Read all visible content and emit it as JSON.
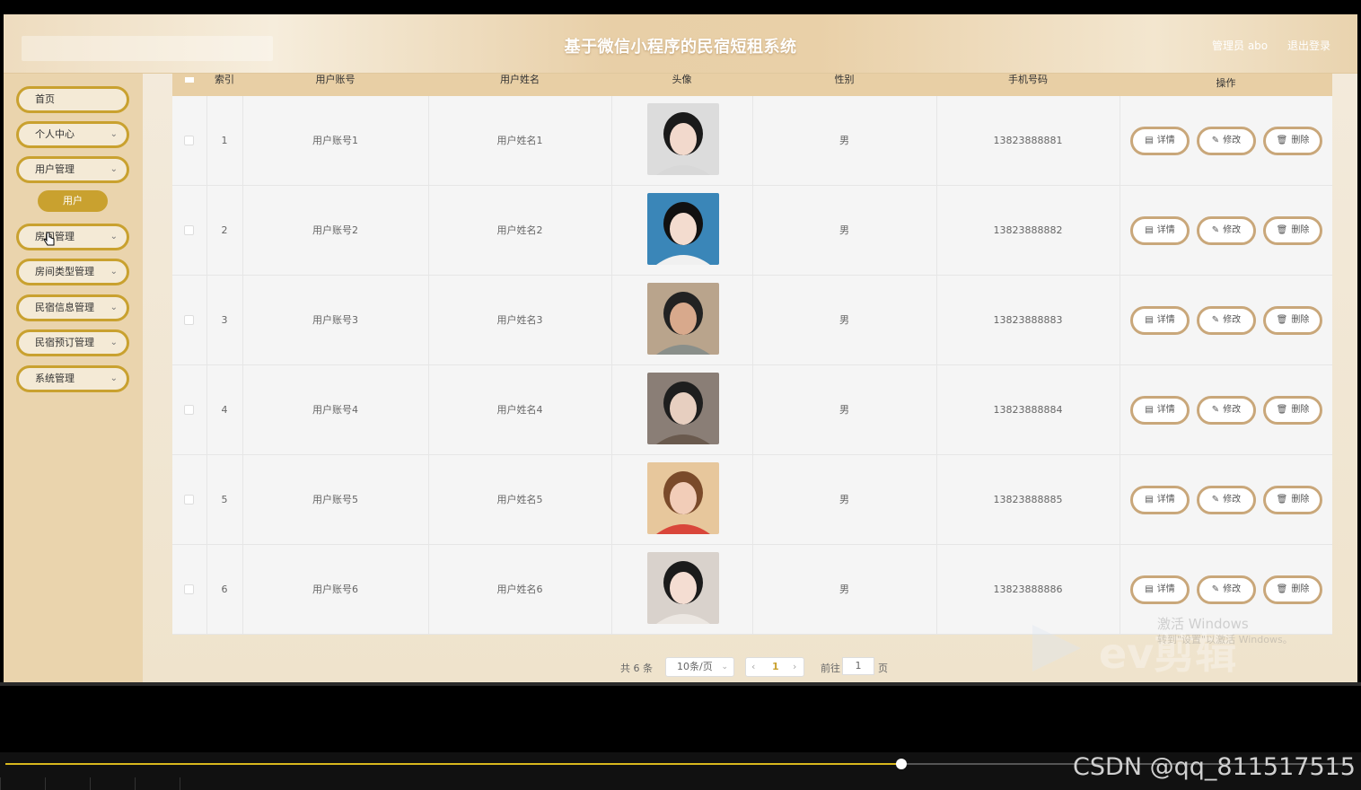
{
  "header": {
    "title": "基于微信小程序的民宿短租系统",
    "user_label": "管理员 abo",
    "logout_label": "退出登录"
  },
  "sidebar": {
    "items": [
      {
        "label": "首页",
        "has_chevron": false
      },
      {
        "label": "个人中心",
        "has_chevron": true
      },
      {
        "label": "用户管理",
        "has_chevron": true
      },
      {
        "label": "房间管理",
        "has_chevron": true
      },
      {
        "label": "房间类型管理",
        "has_chevron": true
      },
      {
        "label": "民宿信息管理",
        "has_chevron": true
      },
      {
        "label": "民宿预订管理",
        "has_chevron": true
      },
      {
        "label": "系统管理",
        "has_chevron": true
      }
    ],
    "sub_item": "用户"
  },
  "table": {
    "headers": [
      "索引",
      "用户账号",
      "用户姓名",
      "头像",
      "性别",
      "手机号码",
      "操作"
    ],
    "rows": [
      {
        "index": "1",
        "account": "用户账号1",
        "name": "用户姓名1",
        "gender": "男",
        "phone": "13823888881"
      },
      {
        "index": "2",
        "account": "用户账号2",
        "name": "用户姓名2",
        "gender": "男",
        "phone": "13823888882"
      },
      {
        "index": "3",
        "account": "用户账号3",
        "name": "用户姓名3",
        "gender": "男",
        "phone": "13823888883"
      },
      {
        "index": "4",
        "account": "用户账号4",
        "name": "用户姓名4",
        "gender": "男",
        "phone": "13823888884"
      },
      {
        "index": "5",
        "account": "用户账号5",
        "name": "用户姓名5",
        "gender": "男",
        "phone": "13823888885"
      },
      {
        "index": "6",
        "account": "用户账号6",
        "name": "用户姓名6",
        "gender": "男",
        "phone": "13823888886"
      }
    ],
    "actions": {
      "detail": "详情",
      "edit": "修改",
      "delete": "删除"
    }
  },
  "pagination": {
    "total": "共 6 条",
    "page_size": "10条/页",
    "current_page": "1",
    "goto_label": "前往",
    "goto_value": "1",
    "page_suffix": "页"
  },
  "overlay": {
    "watermark_brand": "ev剪辑",
    "activate_line1": "激活 Windows",
    "activate_line2": "转到\"设置\"以激活 Windows。",
    "csdn_credit": "CSDN @qq_811517515"
  },
  "player": {
    "progress_fraction": 0.665
  },
  "colors": {
    "accent": "#c9a12f",
    "header_bg": "#e8cfa7",
    "table_header": "#e8cfa5",
    "action_border": "#c9a77a"
  }
}
